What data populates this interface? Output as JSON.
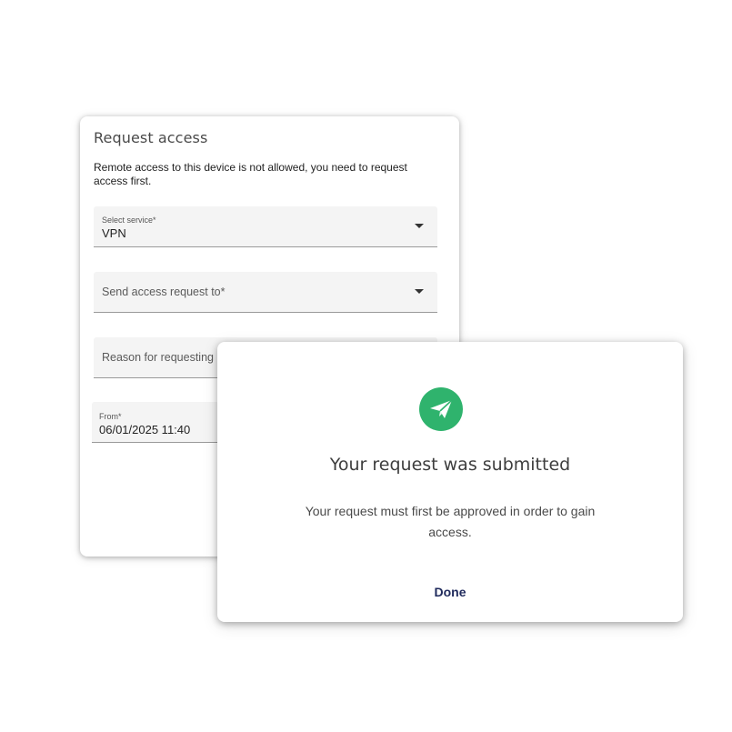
{
  "request_dialog": {
    "title": "Request access",
    "description": "Remote access to this device is not allowed, you need to request access first.",
    "service_field": {
      "label": "Select service*",
      "value": "VPN"
    },
    "recipient_field": {
      "placeholder": "Send access request to*"
    },
    "reason_field": {
      "placeholder": "Reason for requesting"
    },
    "from_field": {
      "label": "From*",
      "value": "06/01/2025 11:40"
    }
  },
  "confirm_dialog": {
    "icon": "paper-plane-icon",
    "title": "Your request was submitted",
    "message": "Your request must first be approved in order to gain access.",
    "done_label": "Done",
    "accent_color": "#2fb36d",
    "button_color": "#1f2a5c"
  }
}
